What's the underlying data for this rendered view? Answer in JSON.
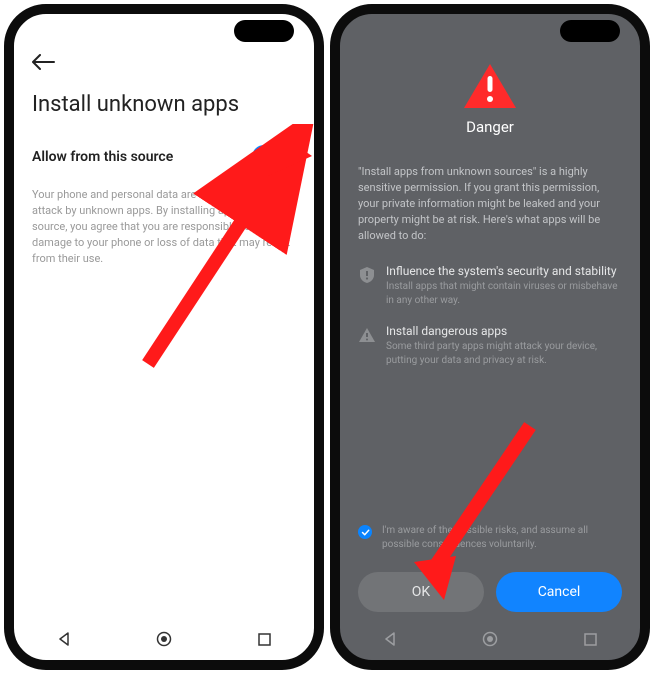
{
  "left": {
    "title": "Install unknown apps",
    "toggle_label": "Allow from this source",
    "description": "Your phone and personal data are more vulnerable to attack by unknown apps. By installing apps from this source, you agree that you are responsible for any damage to your phone or loss of data that may result from their use."
  },
  "right": {
    "title": "Danger",
    "description": "\"Install apps from unknown sources\" is a highly sensitive permission. If you grant this permission, your private information might be leaked and your property might be at risk. Here's what apps will be allowed to do:",
    "items": [
      {
        "head": "Influence the system's security and stability",
        "sub": "Install apps that might contain viruses or misbehave in any other way."
      },
      {
        "head": "Install dangerous apps",
        "sub": "Some third party apps might attack your device, putting your data and privacy at risk."
      }
    ],
    "checkbox_text": "I'm aware of the possible risks, and assume all possible consequences voluntarily.",
    "ok_label": "OK",
    "cancel_label": "Cancel"
  }
}
